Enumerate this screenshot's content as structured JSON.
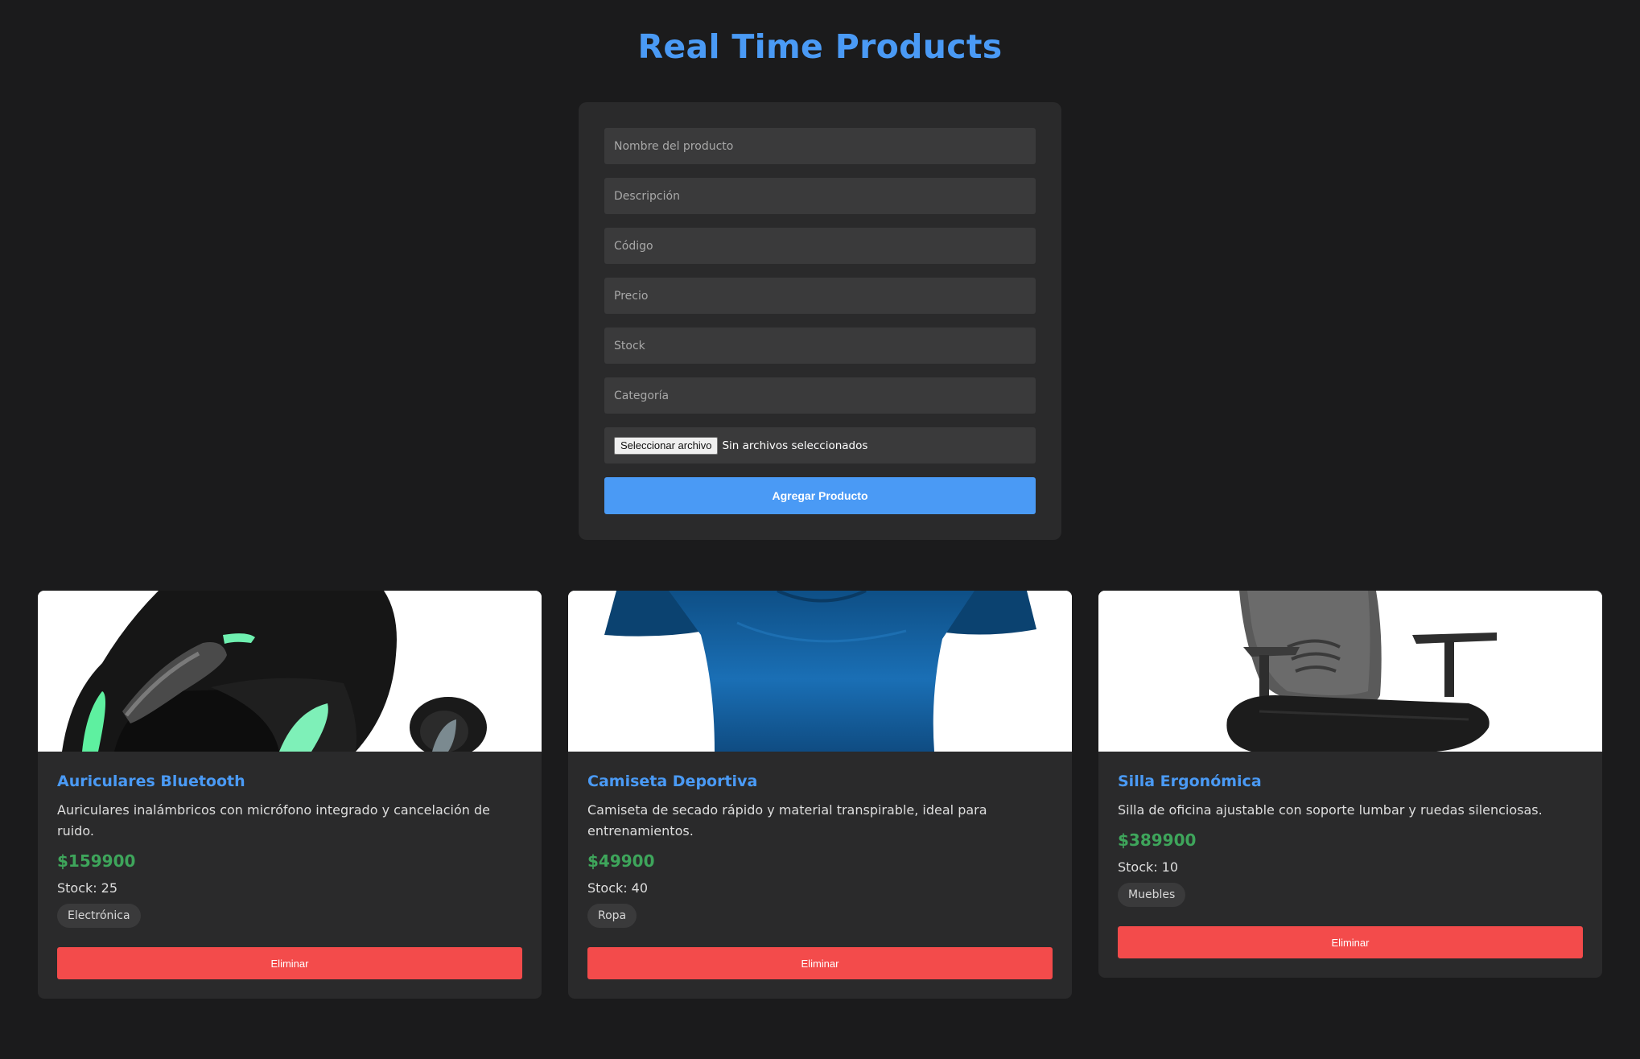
{
  "header": {
    "title": "Real Time Products"
  },
  "form": {
    "name_placeholder": "Nombre del producto",
    "description_placeholder": "Descripción",
    "code_placeholder": "Código",
    "price_placeholder": "Precio",
    "stock_placeholder": "Stock",
    "category_placeholder": "Categoría",
    "file_button_label": "Seleccionar archivo",
    "file_status": "Sin archivos seleccionados",
    "submit_label": "Agregar Producto"
  },
  "products": [
    {
      "name": "Auriculares Bluetooth",
      "description": "Auriculares inalámbricos con micrófono integrado y cancelación de ruido.",
      "price": "$159900",
      "stock_label": "Stock:",
      "stock": "25",
      "category": "Electrónica",
      "delete_label": "Eliminar",
      "image_icon": "earbuds-image"
    },
    {
      "name": "Camiseta Deportiva",
      "description": "Camiseta de secado rápido y material transpirable, ideal para entrenamientos.",
      "price": "$49900",
      "stock_label": "Stock:",
      "stock": "40",
      "category": "Ropa",
      "delete_label": "Eliminar",
      "image_icon": "tshirt-image"
    },
    {
      "name": "Silla Ergonómica",
      "description": "Silla de oficina ajustable con soporte lumbar y ruedas silenciosas.",
      "price": "$389900",
      "stock_label": "Stock:",
      "stock": "10",
      "category": "Muebles",
      "delete_label": "Eliminar",
      "image_icon": "office-chair-image"
    }
  ],
  "colors": {
    "background": "#1b1b1c",
    "card": "#2a2a2b",
    "accent_blue": "#4a9af5",
    "price_green": "#3ea55b",
    "danger_red": "#f34b4b"
  }
}
